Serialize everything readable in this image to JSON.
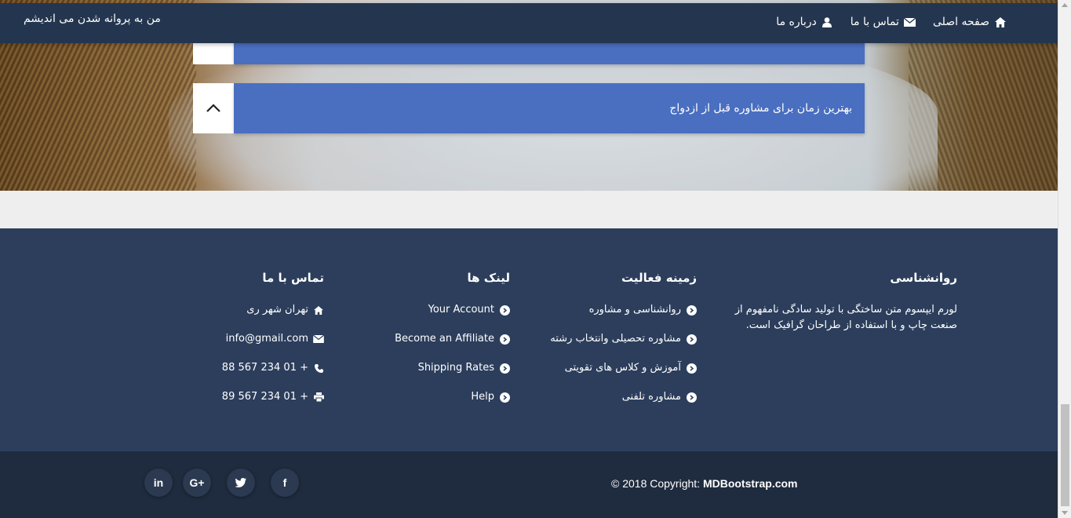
{
  "navbar": {
    "brand": "من به پروانه شدن می اندیشم",
    "links": [
      {
        "label": "صفحه اصلی",
        "icon": "home-icon"
      },
      {
        "label": "تماس با ما",
        "icon": "envelope-icon"
      },
      {
        "label": "درباره ما",
        "icon": "user-icon"
      }
    ]
  },
  "accordion": {
    "items": [
      {
        "title": ""
      },
      {
        "title": "بهترین زمان برای مشاوره قبل از ازدواج"
      }
    ]
  },
  "footer": {
    "about": {
      "title": "روانشناسی",
      "text": "لورم ایپسوم متن ساختگی با تولید سادگی نامفهوم از صنعت چاپ و با استفاده از طراحان گرافیک است."
    },
    "services": {
      "title": "زمینه فعالیت",
      "items": [
        "روانشناسی و مشاوره",
        "مشاوره تحصیلی وانتخاب رشته",
        "آموزش و کلاس های تقویتی",
        "مشاوره تلفنی"
      ]
    },
    "links": {
      "title": "لینک ها",
      "items": [
        "Your Account",
        "Become an Affiliate",
        "Shipping Rates",
        "Help"
      ]
    },
    "contact": {
      "title": "تماس با ما",
      "address": "تهران شهر ری",
      "email": "info@gmail.com",
      "phone": "+ 01 234 567 88",
      "fax": "+ 01 234 567 89"
    }
  },
  "copyright": {
    "prefix": "© 2018 Copyright:",
    "site": "MDBootstrap.com"
  },
  "social": [
    {
      "icon": "facebook-icon",
      "glyph": "f"
    },
    {
      "icon": "twitter-icon",
      "glyph": "t"
    },
    {
      "icon": "google-plus-icon",
      "glyph": "G+"
    },
    {
      "icon": "linkedin-icon",
      "glyph": "in"
    }
  ]
}
